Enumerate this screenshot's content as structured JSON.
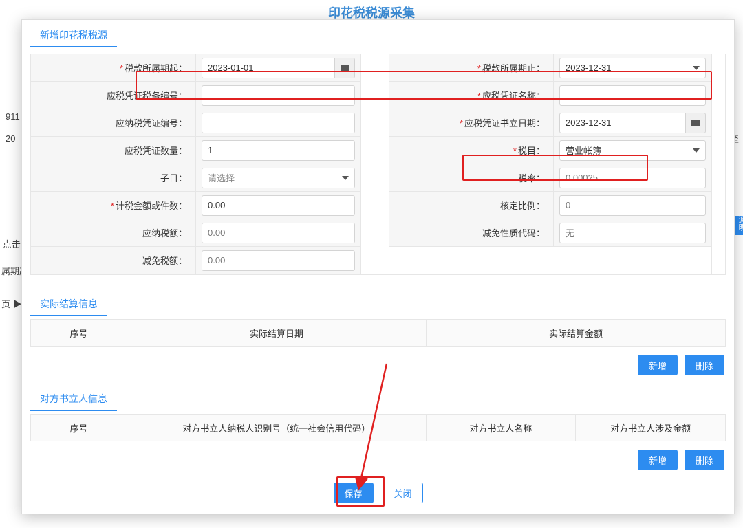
{
  "page": {
    "title": "印花税税源采集"
  },
  "bg": {
    "code": "911",
    "year": "20",
    "hint": "点击",
    "col": "属期起",
    "pager": "页 ▶",
    "to": "至",
    "btn": "源明细"
  },
  "dialog": {
    "sections": {
      "add": "新增印花税税源",
      "settlement": "实际结算信息",
      "counterparty": "对方书立人信息"
    },
    "form": {
      "period_from_label": "税款所属期起：",
      "period_from": "2023-01-01",
      "period_to_label": "税款所属期止：",
      "period_to": "2023-12-31",
      "cert_tax_no_label": "应税凭证税务编号：",
      "cert_tax_no": "",
      "cert_name_label": "应税凭证名称：",
      "cert_name": "",
      "tax_cert_no_label": "应纳税凭证编号：",
      "tax_cert_no": "",
      "cert_date_label": "应税凭证书立日期：",
      "cert_date": "2023-12-31",
      "cert_qty_label": "应税凭证数量：",
      "cert_qty": "1",
      "tax_item_label": "税目：",
      "tax_item": "营业帐簿",
      "sub_item_label": "子目：",
      "sub_item_placeholder": "请选择",
      "tax_rate_label": "税率：",
      "tax_rate": "0.00025",
      "tax_basis_label": "计税金额或件数：",
      "tax_basis": "0.00",
      "assess_ratio_label": "核定比例：",
      "assess_ratio": "0",
      "tax_payable_label": "应纳税额：",
      "tax_payable": "0.00",
      "exempt_code_label": "减免性质代码：",
      "exempt_code": "无",
      "exempt_amt_label": "减免税额：",
      "exempt_amt": "0.00"
    },
    "settlement_table": {
      "sn": "序号",
      "date": "实际结算日期",
      "amount": "实际结算金额"
    },
    "cp_table": {
      "sn": "序号",
      "taxid": "对方书立人纳税人识别号（统一社会信用代码）",
      "name": "对方书立人名称",
      "amount": "对方书立人涉及金额"
    },
    "buttons": {
      "add": "新增",
      "delete": "删除",
      "save": "保存",
      "close": "关闭"
    }
  }
}
